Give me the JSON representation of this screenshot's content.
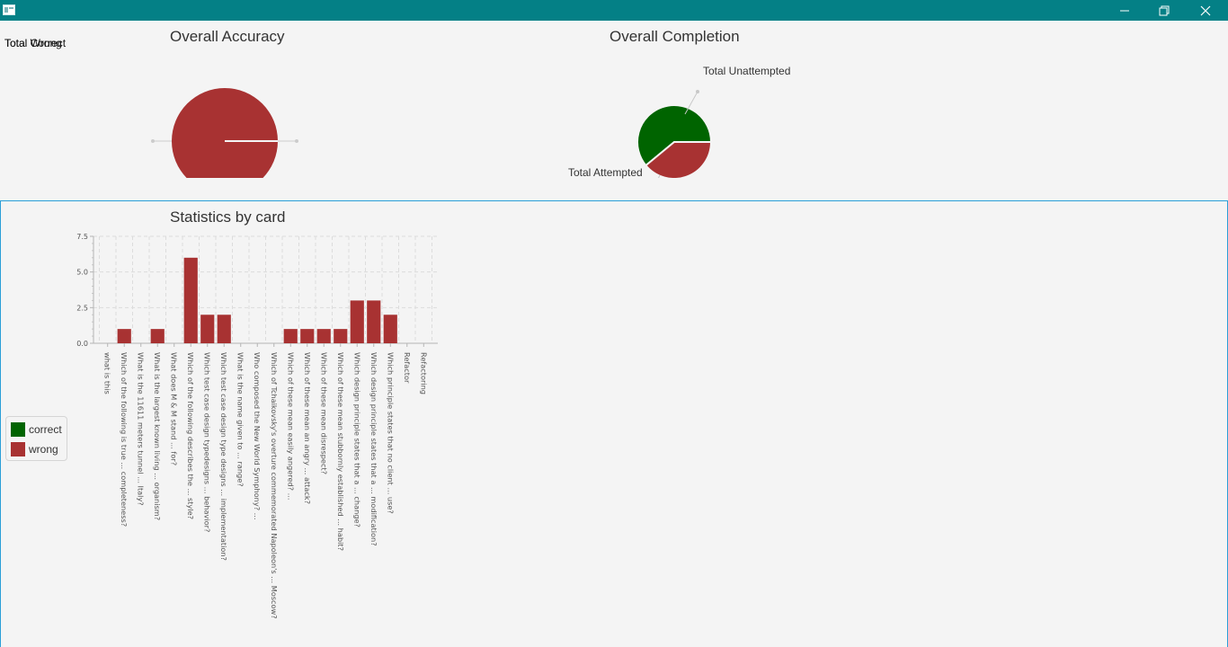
{
  "window": {
    "icon": "app-window-icon",
    "controls": [
      {
        "name": "minimize-button",
        "icon": "minimize-icon"
      },
      {
        "name": "restore-button",
        "icon": "restore-icon"
      },
      {
        "name": "close-button",
        "icon": "close-icon"
      }
    ],
    "titlebar_color": "#048086"
  },
  "overlapping_label": {
    "first": "Total Correct",
    "second": "Total Wrong"
  },
  "colors": {
    "correct": "#006400",
    "wrong": "#a83232",
    "accent_border": "#2a9fd8"
  },
  "chart_data": [
    {
      "type": "pie",
      "title": "Overall Accuracy",
      "slices": [
        {
          "label": "Total Correct",
          "value": 0,
          "color": "#006400"
        },
        {
          "label": "Total Wrong",
          "value": 100,
          "color": "#a83232"
        }
      ]
    },
    {
      "type": "pie",
      "title": "Overall Completion",
      "slices": [
        {
          "label": "Total Attempted",
          "value": 61,
          "color": "#006400"
        },
        {
          "label": "Total Unattempted",
          "value": 39,
          "color": "#a83232"
        }
      ]
    },
    {
      "type": "bar",
      "title": "Statistics by card",
      "ylim": [
        0,
        7.5
      ],
      "yticks": [
        "0.0",
        "2.5",
        "5.0",
        "7.5"
      ],
      "legend_position": "left",
      "categories": [
        "what is this",
        "Which of the following is true ... completeness?",
        "What is the 11611 meters tunnel ... Italy?",
        "What is the largest known living ... organism?",
        "What does M & M stand ... for?",
        "Which of the following describes the ... style?",
        "Which test case design typedesigns ... behavior?",
        "Which test case design type designs ... implementation?",
        "What is the name given to ... range?",
        "Who composed the New World Symphony? ...",
        "Which of Tchaikovsky's overture commemorated Napoleon's ... Moscow?",
        "Which of these mean easily angered? ...",
        "Which of these mean an angry ... attack?",
        "Which of these mean disrespect?",
        "Which of these mean stubbornly established ... habit?",
        "Which design principle states that a ... change?",
        "Which design principle states that a ... modification?",
        "Which principle states that no client ... use?",
        "Refactor",
        "Refactoring"
      ],
      "series": [
        {
          "name": "correct",
          "color": "#006400",
          "values": [
            0,
            0,
            0,
            0,
            0,
            0,
            0,
            0,
            0,
            0,
            0,
            0,
            0,
            0,
            0,
            0,
            0,
            0,
            0,
            0
          ]
        },
        {
          "name": "wrong",
          "color": "#a83232",
          "values": [
            0,
            1,
            0,
            1,
            0,
            6,
            2,
            2,
            0,
            0,
            0,
            1,
            1,
            1,
            1,
            3,
            3,
            2,
            0,
            0
          ]
        }
      ]
    }
  ]
}
